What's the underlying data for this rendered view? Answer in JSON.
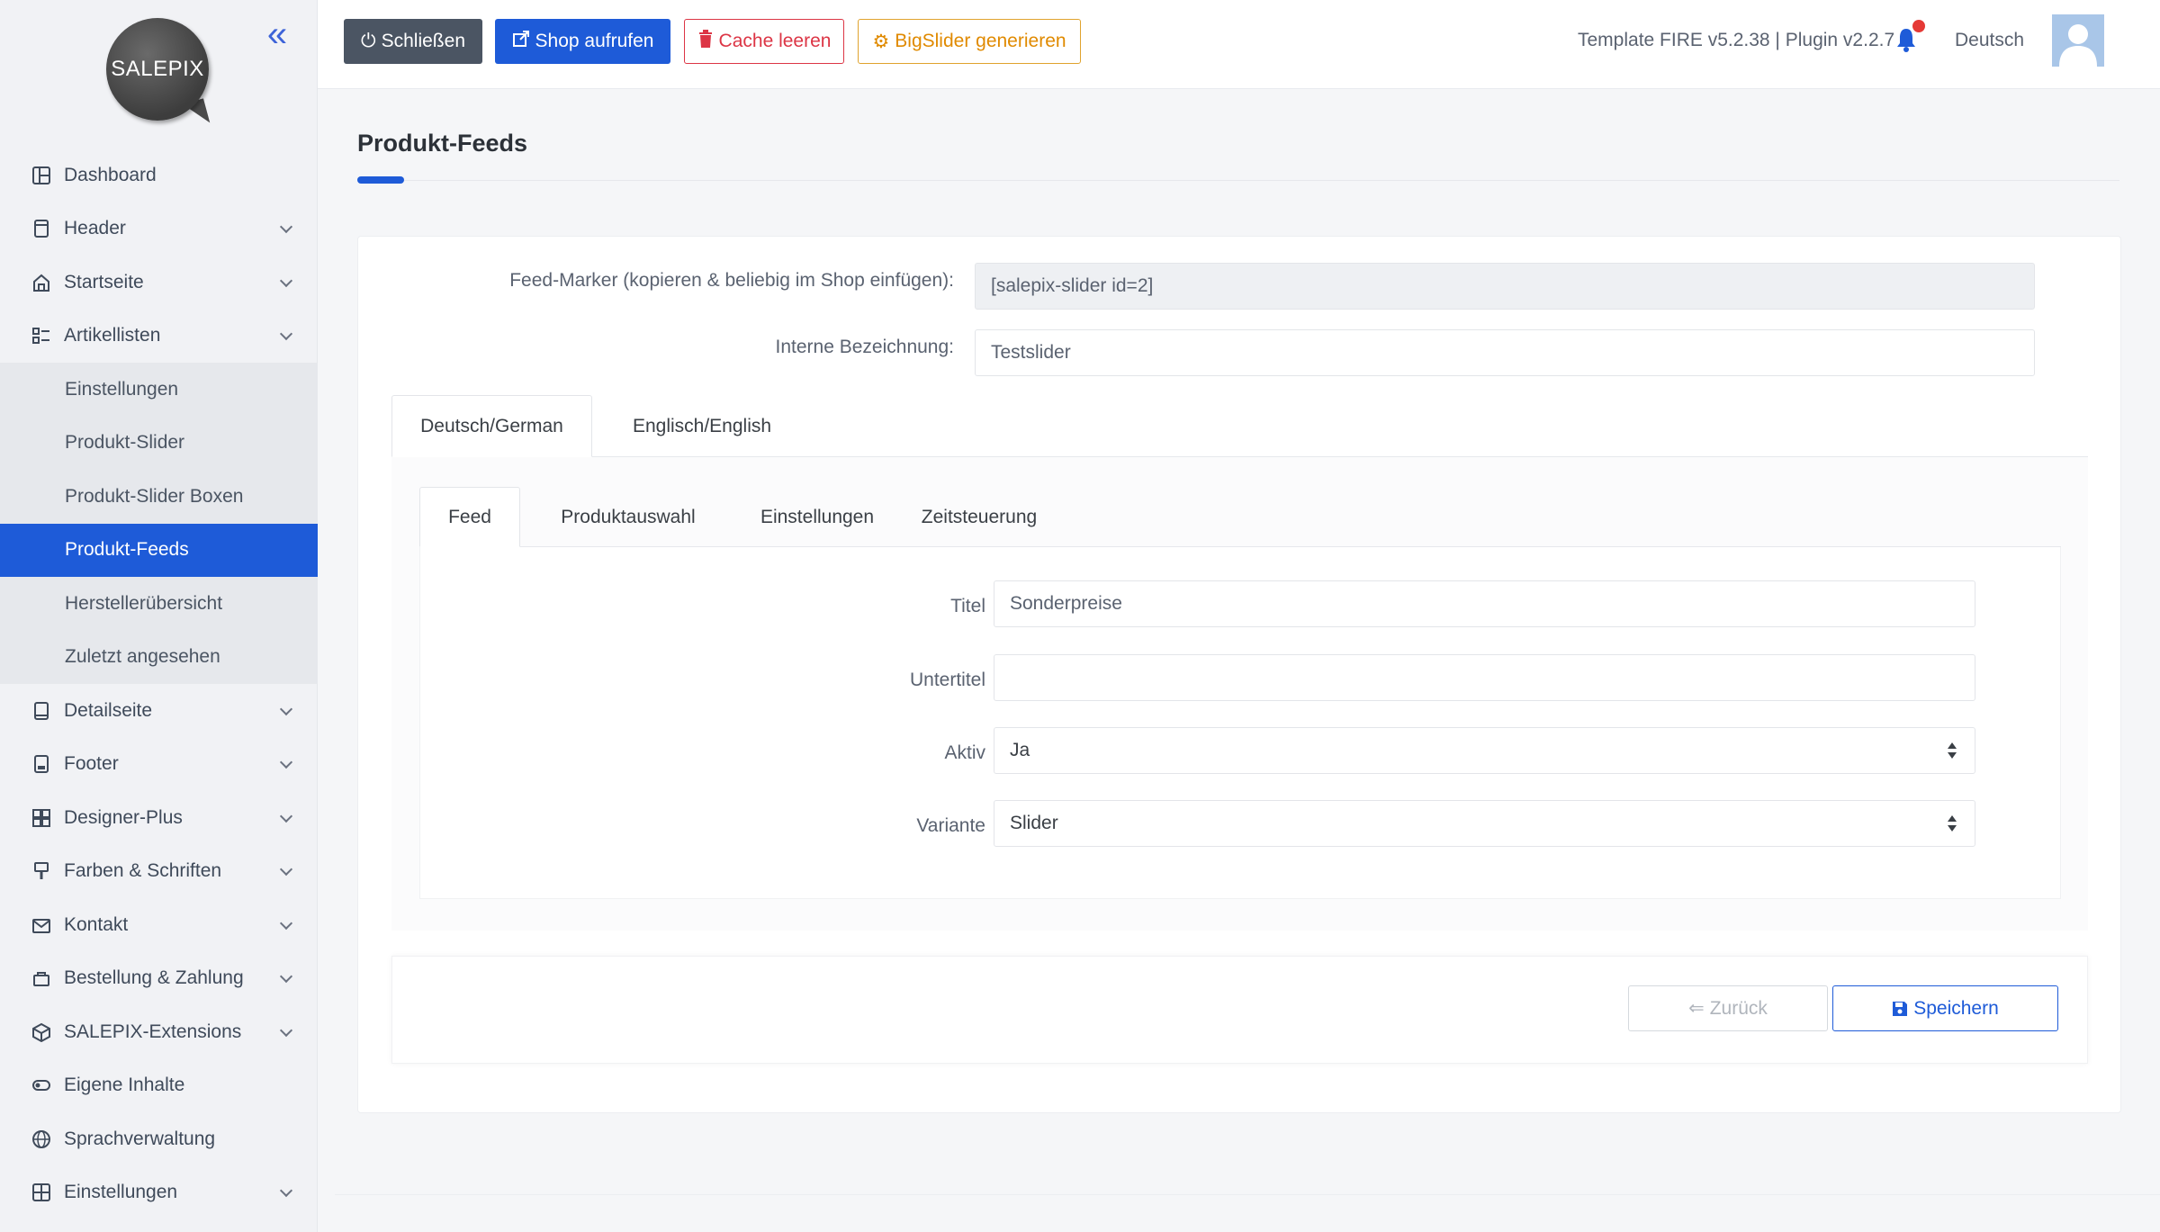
{
  "sidebar": {
    "logo_text": "SALEPIX",
    "collapse_icon": "double-chevron-left-icon",
    "items": [
      {
        "label": "Dashboard",
        "icon": "dashboard-icon",
        "has_chevron": false
      },
      {
        "label": "Header",
        "icon": "header-icon",
        "has_chevron": true
      },
      {
        "label": "Startseite",
        "icon": "home-icon",
        "has_chevron": true
      },
      {
        "label": "Artikellisten",
        "icon": "list-icon",
        "has_chevron": true
      }
    ],
    "sub_items": [
      {
        "label": "Einstellungen"
      },
      {
        "label": "Produkt-Slider"
      },
      {
        "label": "Produkt-Slider Boxen"
      },
      {
        "label": "Produkt-Feeds",
        "active": true
      },
      {
        "label": "Herstellerübersicht"
      },
      {
        "label": "Zuletzt angesehen"
      }
    ],
    "items_after": [
      {
        "label": "Detailseite",
        "icon": "tablet-icon",
        "has_chevron": true
      },
      {
        "label": "Footer",
        "icon": "footer-icon",
        "has_chevron": true
      },
      {
        "label": "Designer-Plus",
        "icon": "grid-plus-icon",
        "has_chevron": true
      },
      {
        "label": "Farben & Schriften",
        "icon": "paint-icon",
        "has_chevron": true
      },
      {
        "label": "Kontakt",
        "icon": "mail-icon",
        "has_chevron": true
      },
      {
        "label": "Bestellung & Zahlung",
        "icon": "basket-icon",
        "has_chevron": true
      },
      {
        "label": "SALEPIX-Extensions",
        "icon": "box-icon",
        "has_chevron": true
      },
      {
        "label": "Eigene Inhalte",
        "icon": "toggle-icon",
        "has_chevron": false
      },
      {
        "label": "Sprachverwaltung",
        "icon": "globe-icon",
        "has_chevron": false
      },
      {
        "label": "Einstellungen",
        "icon": "settings-grid-icon",
        "has_chevron": true
      }
    ]
  },
  "topbar": {
    "close_label": "Schließen",
    "shop_label": "Shop aufrufen",
    "cache_label": "Cache leeren",
    "bigslider_label": "BigSlider generieren",
    "version": "Template FIRE v5.2.38 | Plugin v2.2.7",
    "language": "Deutsch"
  },
  "page": {
    "title": "Produkt-Feeds"
  },
  "form": {
    "marker_label": "Feed-Marker (kopieren & beliebig im Shop einfügen):",
    "marker_value": "[salepix-slider id=2]",
    "internal_label": "Interne Bezeichnung:",
    "internal_value": "Testslider",
    "lang_tabs": [
      "Deutsch/German",
      "Englisch/English"
    ],
    "inner_tabs": [
      "Feed",
      "Produktauswahl",
      "Einstellungen",
      "Zeitsteuerung"
    ],
    "titel_label": "Titel",
    "titel_value": "Sonderpreise",
    "untertitel_label": "Untertitel",
    "untertitel_value": "",
    "aktiv_label": "Aktiv",
    "aktiv_value": "Ja",
    "variante_label": "Variante",
    "variante_value": "Slider",
    "back_label": "Zurück",
    "save_label": "Speichern"
  },
  "colors": {
    "primary": "#1e5bd8",
    "danger": "#dc3545",
    "warning": "#e08a00",
    "dark": "#4b5563"
  }
}
